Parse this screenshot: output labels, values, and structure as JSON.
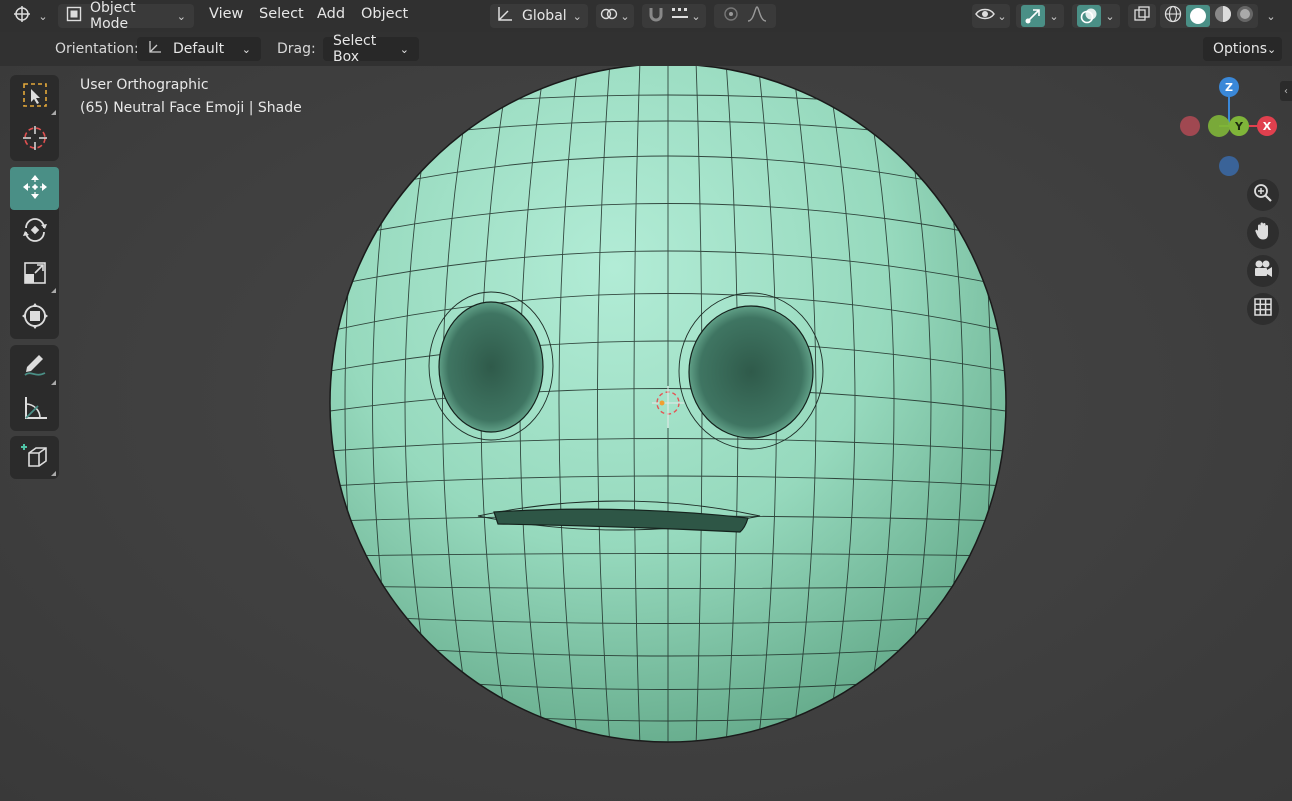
{
  "header": {
    "mode_label": "Object Mode",
    "menus": [
      "View",
      "Select",
      "Add",
      "Object"
    ],
    "transform_orientation": "Global"
  },
  "tool_header": {
    "orientation_label": "Orientation:",
    "orientation_value": "Default",
    "drag_label": "Drag:",
    "drag_value": "Select Box",
    "options_label": "Options"
  },
  "viewport": {
    "view_name": "User Orthographic",
    "object_info": "(65) Neutral Face Emoji | Shade"
  },
  "gizmo": {
    "z_label": "Z",
    "y_label": "Y",
    "x_label": "X"
  },
  "colors": {
    "accent": "#4a8f86",
    "mesh": "#98dcc0",
    "x_axis": "#e0404e",
    "y_axis": "#7fb539",
    "z_axis": "#3a88d8"
  },
  "icons": {
    "toolbar": [
      "select-box-icon",
      "cursor-icon",
      "move-icon",
      "rotate-icon",
      "scale-icon",
      "transform-icon",
      "annotate-icon",
      "measure-icon",
      "add-cube-icon"
    ],
    "navigation": [
      "zoom-icon",
      "hand-pan-icon",
      "camera-icon",
      "grid-icon"
    ]
  }
}
